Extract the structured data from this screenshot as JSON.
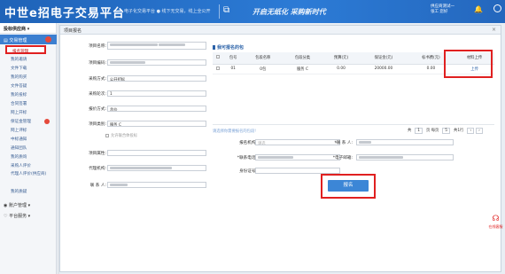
{
  "header": {
    "logo": "中世e招电子交易平台",
    "slogan1": "电子化交易平台 ● 线下无交易，线上全公开",
    "slogan2": "开启无纸化 采购新时代",
    "user_line1": "供应商测试一",
    "user_line2": "张工 您好"
  },
  "sidebar": {
    "header": "投标供应商",
    "group": "交易管理",
    "items": [
      "报名管理",
      "我的邀请",
      "文件下载",
      "我的购买",
      "文件答疑",
      "我的投标",
      "合同签署",
      "网上开标",
      "保证金管理",
      "网上评标",
      "中标通知",
      "通知团队",
      "我的质询",
      "采购人评价",
      "代理人评价(供应商)",
      "我的质疑"
    ],
    "sub1": "账户管理",
    "sub2": "平台服务"
  },
  "main": {
    "tab_title": "项目报名",
    "close": "×",
    "form": {
      "project_name_label": "项目名称:",
      "project_code_label": "项目编码:",
      "purchase_method_label": "采购方式:",
      "purchase_method_value": "公开招标",
      "round_label": "采购轮次:",
      "round_value": "1",
      "bid_method_label": "报价方式:",
      "bid_method_value": "总价",
      "project_category_label": "项目类别:",
      "project_category_value": "服务 C",
      "allow_union": "允许联合体投标",
      "project_region_label": "项目属性:",
      "agency_label": "代理机构:",
      "contact_label": "联 系 人:"
    },
    "package_panel": {
      "title": "我可报名的包",
      "columns": [
        "",
        "包号",
        "包段名称",
        "包段分类",
        "预算(元)",
        "保证金(元)",
        "标书费(元)",
        "材料上传"
      ],
      "rows": [
        {
          "no": "01",
          "name": "0包",
          "category": "服务 C",
          "budget": "0.00",
          "deposit": "20000.00",
          "fee": "0.00",
          "upload": "上传"
        }
      ],
      "hint": "请选择你需要报名的包段!",
      "pager_total": "共",
      "pager_page": "1",
      "pager_per": "页 每页",
      "pager_size": "5",
      "pager_suffix": "共1行",
      "pager_prev": "‹",
      "pager_next": "›"
    },
    "signup_form": {
      "signup_type_label": "报名机构:",
      "signup_type_placeholder": "请选",
      "contact_label": "*联 系 人:",
      "phone_label": "*联系电话:",
      "email_label": "*电子邮箱:",
      "id_label": "身份证号:",
      "submit": "报名"
    }
  },
  "float_service": "在线客服"
}
